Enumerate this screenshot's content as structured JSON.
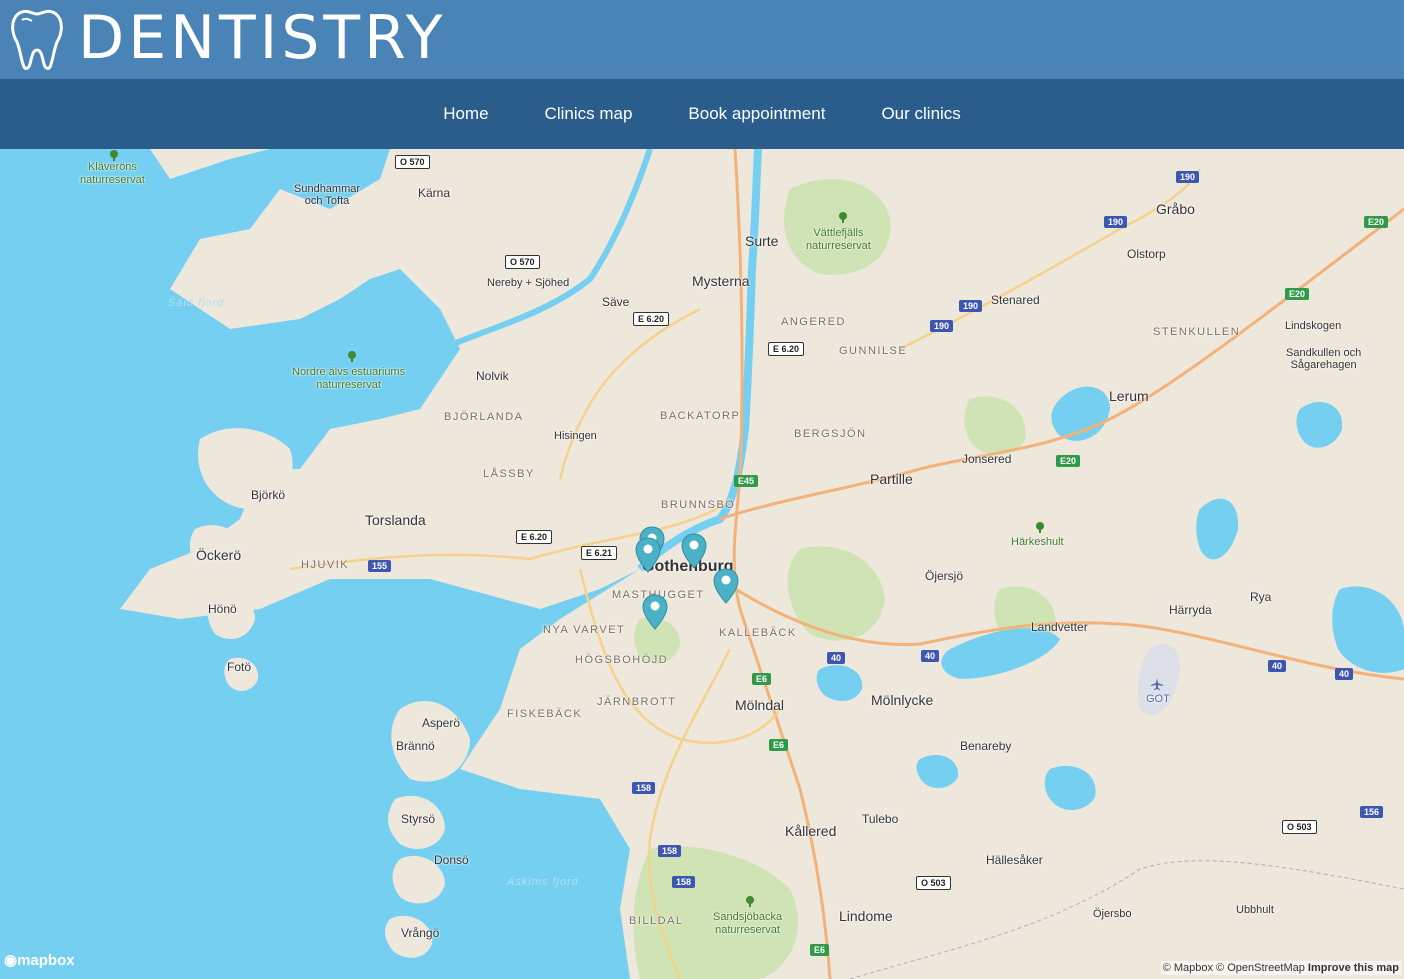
{
  "brand": {
    "title": "DENTISTRY",
    "logo_icon": "tooth-icon"
  },
  "nav": {
    "items": [
      "Home",
      "Clinics map",
      "Book appointment",
      "Our clinics"
    ]
  },
  "map": {
    "labels": {
      "klaverons": "Kläveröns\nnaturreservat",
      "sundhammar": "Sundhammar\noch Tofta",
      "karna": "Kärna",
      "surte": "Surte",
      "vattlefjall": "Vättlefjälls\nnaturreservat",
      "grabo": "Gråbo",
      "olstorp": "Olstorp",
      "nereby": "Nereby + Sjöhed",
      "mysterna": "Mysterna",
      "save": "Säve",
      "salo": "Sälö fjord",
      "angered": "ANGERED",
      "stenared": "Stenared",
      "stenkullen": "STENKULLEN",
      "lindskogen": "Lindskogen",
      "sandkullen": "Sandkullen och\nSågarehagen",
      "gunnilse": "GUNNILSE",
      "nordre": "Nordre älvs estuariums\nnaturreservat",
      "nolvik": "Nolvik",
      "lerum": "Lerum",
      "bjorlanda": "BJÖRLANDA",
      "backatorp": "BACKATORP",
      "hisingen": "Hisingen",
      "bergsjon": "BERGSJÖN",
      "jonsered": "Jonsered",
      "lassby": "LÅSSBY",
      "partille": "Partille",
      "bjorko": "Björkö",
      "brunnsbo": "BRUNNSBO",
      "torslanda": "Torslanda",
      "harkeshult": "Härkeshult",
      "ockero": "Öckerö",
      "hjuvik": "HJUVIK",
      "gothenburg": "Gothenburg",
      "ojersjo": "Öjersjö",
      "masthugget": "MASTHUGGET",
      "hono": "Hönö",
      "rya": "Rya",
      "harryda": "Härryda",
      "nyavarvet": "NYA VARVET",
      "kalleback": "KALLEBÄCK",
      "landvetter": "Landvetter",
      "foto": "Fotö",
      "hogsbohojd": "HÖGSBOHÖJD",
      "got": "GOT",
      "jarnbrott": "JÄRNBROTT",
      "molndal": "Mölndal",
      "molnlycke": "Mölnlycke",
      "fiskeback": "FISKEBÄCK",
      "aspero": "Asperö",
      "branno": "Brännö",
      "benareby": "Benareby",
      "styrso": "Styrsö",
      "tulebo": "Tulebo",
      "kallered": "Kållered",
      "donso": "Donsö",
      "hallesaker": "Hällesåker",
      "askims": "Askims fjord",
      "billdal": "BILLDAL",
      "sandsjobacka": "Sandsjöbacka\nnaturreservat",
      "lindome": "Lindome",
      "ojersbo": "Öjersbo",
      "ubbhult": "Ubbhult",
      "vrango": "Vrångö"
    },
    "shields": {
      "r570a": "O 570",
      "r570b": "O 570",
      "e620a": "E 6.20",
      "e620b": "E 6.20",
      "e620c": "E 6.20",
      "e621": "E 6.21",
      "r190a": "190",
      "r190b": "190",
      "r190c": "190",
      "r190d": "190",
      "e20a": "E20",
      "e20b": "E20",
      "e20c": "E20",
      "e45": "E45",
      "r155": "155",
      "r40a": "40",
      "r40b": "40",
      "r40c": "40",
      "r40d": "40",
      "e6a": "E6",
      "e6b": "E6",
      "e6c": "E6",
      "r158a": "158",
      "r158b": "158",
      "r158c": "158",
      "r156": "156",
      "o503a": "O 503",
      "o503b": "O 503"
    },
    "markers": [
      "clinic-marker-1",
      "clinic-marker-2",
      "clinic-marker-3",
      "clinic-marker-4",
      "clinic-marker-5"
    ],
    "logo": "mapbox",
    "attribution": {
      "mapbox": "© Mapbox",
      "osm": "© OpenStreetMap",
      "improve": "Improve this map"
    }
  },
  "colors": {
    "header": "#4a83b5",
    "nav": "#2a5c8c",
    "water": "#75cff0",
    "land": "#eee7dc",
    "park": "#cfe3b4",
    "marker": "#4ab1c7"
  }
}
